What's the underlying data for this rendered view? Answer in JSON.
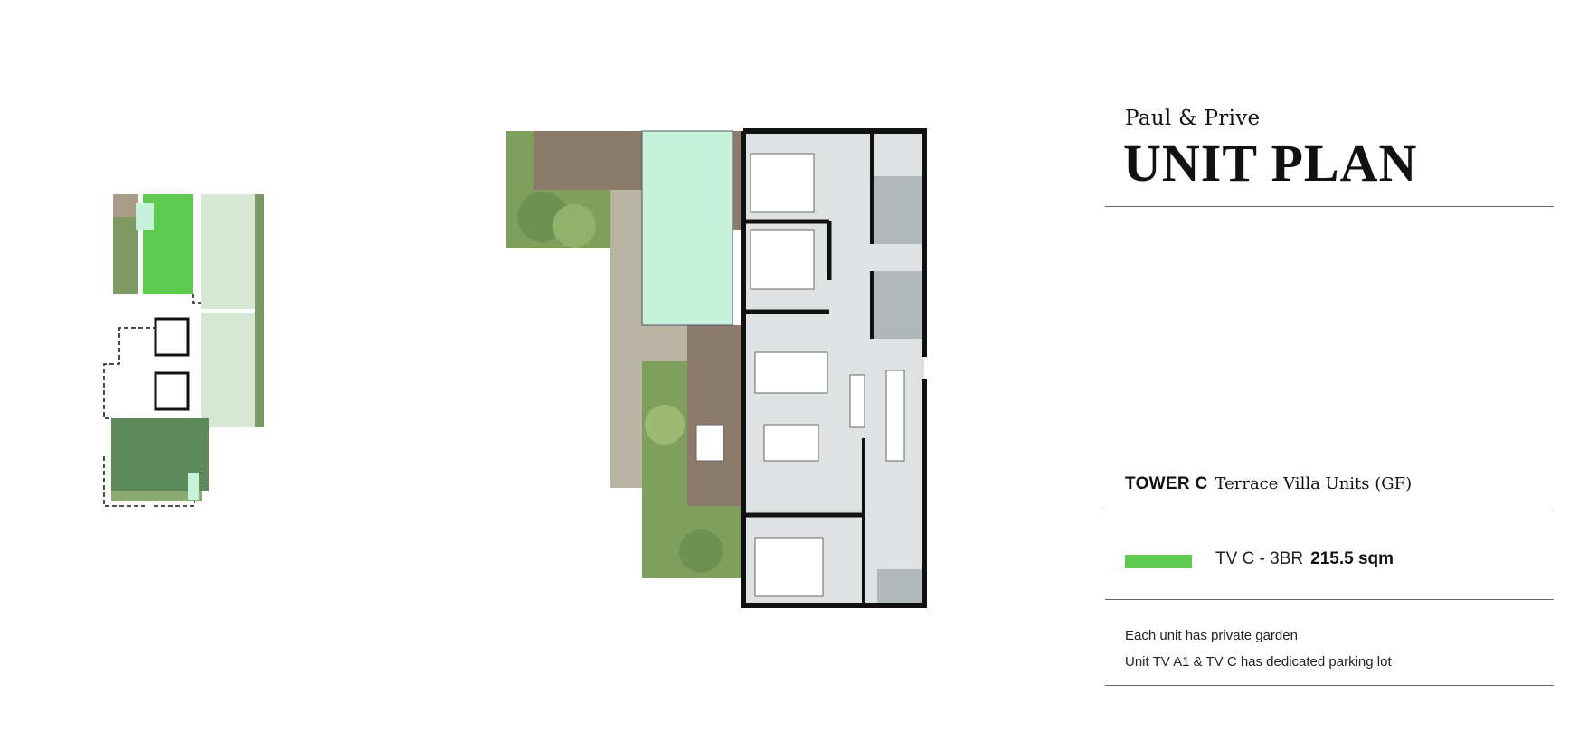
{
  "header": {
    "brand": "Paul & Prive",
    "title": "UNIT PLAN"
  },
  "tower": {
    "name": "TOWER C",
    "subtitle": "Terrace Villa Units (GF)"
  },
  "unit": {
    "code": "TV C - 3BR",
    "area": "215.5 sqm",
    "swatch_color": "#5ccb4e"
  },
  "notes": [
    "Each unit has private garden",
    "Unit TV A1 & TV C has dedicated parking lot"
  ],
  "colors": {
    "highlight_green": "#5ccb4e",
    "block_green": "#5d8a5b",
    "pale_green": "#d6e8d4",
    "pool": "#c6f1da",
    "deck": "#8c7a6a",
    "floor": "#dfe2e2",
    "paving": "#b9b3a2"
  }
}
